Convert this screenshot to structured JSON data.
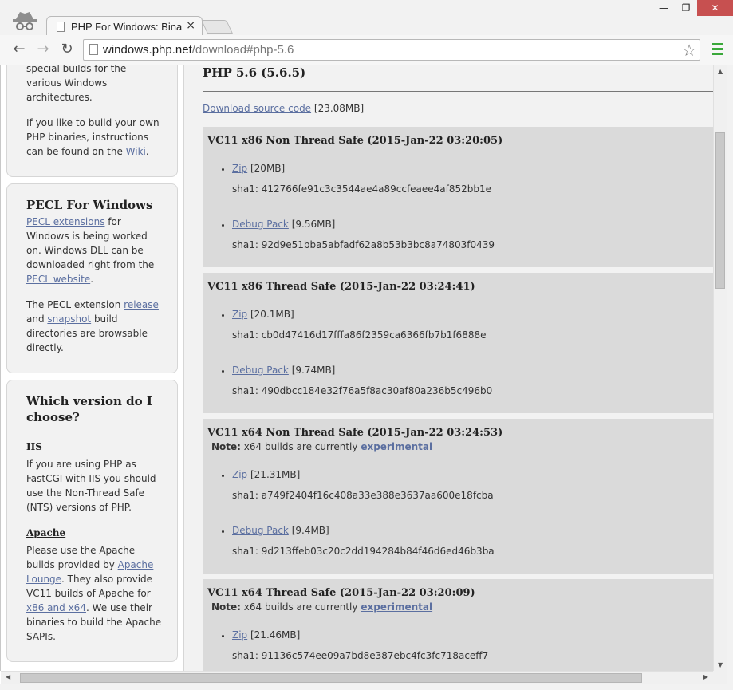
{
  "browser": {
    "tab_title": "PHP For Windows: Binaries and sources Releases",
    "tab_close": "×",
    "url_host": "windows.php.net",
    "url_path": "/download#php-5.6",
    "win_min": "—",
    "win_max": "❐",
    "win_close": "✕",
    "back": "←",
    "forward": "→",
    "reload": "↻",
    "star": "☆"
  },
  "sidebar": {
    "intro": {
      "line1": "special builds for the various Windows architectures.",
      "line2_pre": "If you like to build your own PHP binaries, instructions can be found on the ",
      "line2_link": "Wiki",
      "line2_post": "."
    },
    "pecl": {
      "title": "PECL For Windows",
      "p1_link1": "PECL extensions",
      "p1_text": " for Windows is being worked on. Windows DLL can be downloaded right from the ",
      "p1_link2": "PECL website",
      "p1_post": ".",
      "p2_pre": "The PECL extension ",
      "p2_link1": "release",
      "p2_mid": " and ",
      "p2_link2": "snapshot",
      "p2_post": " build directories are browsable directly."
    },
    "which": {
      "title": "Which version do I choose?",
      "iis_heading": "IIS",
      "iis_text": "If you are using PHP as FastCGI with IIS you should use the Non-Thread Safe (NTS) versions of PHP.",
      "apache_heading": "Apache",
      "apache_pre": "Please use the Apache builds provided by ",
      "apache_link1": "Apache Lounge",
      "apache_mid": ". They also provide VC11 builds of Apache for ",
      "apache_link2": "x86 and x64",
      "apache_post": ". We use their binaries to build the Apache SAPIs."
    }
  },
  "main": {
    "title": "PHP 5.6 (5.6.5)",
    "source_link": "Download source code",
    "source_size": " [23.08MB]",
    "note_label": "Note:",
    "note_text": " x64 builds are currently ",
    "note_link": "experimental",
    "sha_prefix": "sha1: ",
    "builds": [
      {
        "title": "VC11 x86 Non Thread Safe (2015-Jan-22 03:20:05)",
        "zip_label": "Zip",
        "zip_size": " [20MB]",
        "zip_sha": "412766fe91c3c3544ae4a89ccfeaee4af852bb1e",
        "debug_label": "Debug Pack",
        "debug_size": " [9.56MB]",
        "debug_sha": "92d9e51bba5abfadf62a8b53b3bc8a74803f0439"
      },
      {
        "title": "VC11 x86 Thread Safe (2015-Jan-22 03:24:41)",
        "zip_label": "Zip",
        "zip_size": " [20.1MB]",
        "zip_sha": "cb0d47416d17fffa86f2359ca6366fb7b1f6888e",
        "debug_label": "Debug Pack",
        "debug_size": " [9.74MB]",
        "debug_sha": "490dbcc184e32f76a5f8ac30af80a236b5c496b0"
      },
      {
        "title": "VC11 x64 Non Thread Safe (2015-Jan-22 03:24:53)",
        "zip_label": "Zip",
        "zip_size": " [21.31MB]",
        "zip_sha": "a749f2404f16c408a33e388e3637aa600e18fcba",
        "debug_label": "Debug Pack",
        "debug_size": " [9.4MB]",
        "debug_sha": "9d213ffeb03c20c2dd194284b84f46d6ed46b3ba"
      },
      {
        "title": "VC11 x64 Thread Safe (2015-Jan-22 03:20:09)",
        "zip_label": "Zip",
        "zip_size": " [21.46MB]",
        "zip_sha": "91136c574ee09a7bd8e387ebc4fc3fc718aceff7"
      }
    ]
  }
}
